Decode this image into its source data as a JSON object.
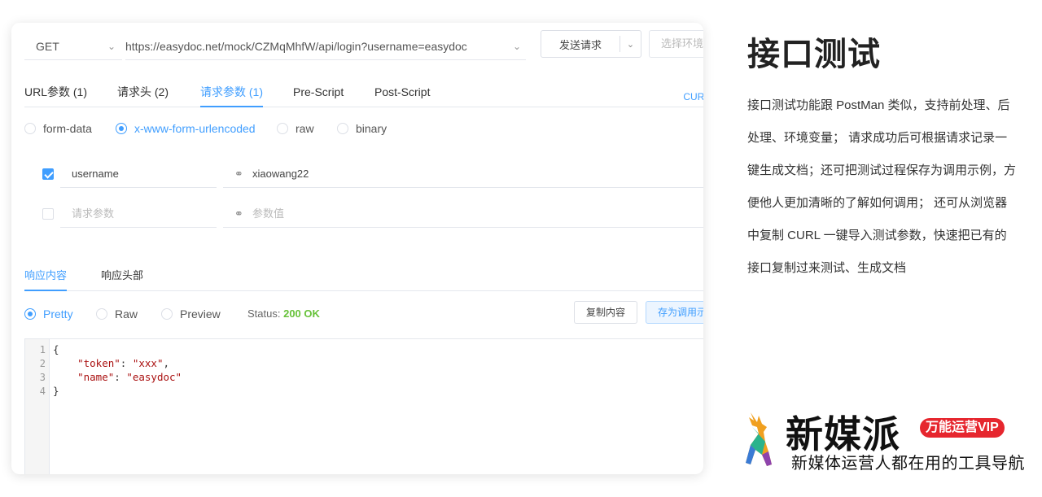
{
  "request": {
    "method": "GET",
    "url": "https://easydoc.net/mock/CZMqMhfW/api/login?username=easydoc",
    "send_label": "发送请求",
    "env_placeholder": "选择环境"
  },
  "tabs": [
    {
      "label": "URL参数 (1)",
      "active": false
    },
    {
      "label": "请求头 (2)",
      "active": false
    },
    {
      "label": "请求参数 (1)",
      "active": true
    },
    {
      "label": "Pre-Script",
      "active": false
    },
    {
      "label": "Post-Script",
      "active": false
    }
  ],
  "curl_label": "CURL导",
  "body_types": [
    {
      "label": "form-data",
      "selected": false
    },
    {
      "label": "x-www-form-urlencoded",
      "selected": true
    },
    {
      "label": "raw",
      "selected": false
    },
    {
      "label": "binary",
      "selected": false
    }
  ],
  "params": [
    {
      "checked": true,
      "key": "username",
      "value": "xiaowang22"
    },
    {
      "checked": false,
      "key_placeholder": "请求参数",
      "value_placeholder": "参数值"
    }
  ],
  "response": {
    "tabs": [
      {
        "label": "响应内容",
        "active": true
      },
      {
        "label": "响应头部",
        "active": false
      }
    ],
    "formats": [
      {
        "label": "Pretty",
        "selected": true
      },
      {
        "label": "Raw",
        "selected": false
      },
      {
        "label": "Preview",
        "selected": false
      }
    ],
    "status_label": "Status:",
    "status_value": "200 OK",
    "status_color": "#67c23a",
    "copy_label": "复制内容",
    "save_label": "存为调用示例",
    "code_lines": [
      {
        "n": "1",
        "text": "{"
      },
      {
        "n": "2",
        "text": "    \"token\": \"xxx\","
      },
      {
        "n": "3",
        "text": "    \"name\": \"easydoc\""
      },
      {
        "n": "4",
        "text": "}"
      }
    ]
  },
  "intro": {
    "title": "接口测试",
    "description": "接口测试功能跟 PostMan 类似，支持前处理、后处理、环境变量； 请求成功后可根据请求记录一键生成文档；还可把测试过程保存为调用示例，方便他人更加清晰的了解如何调用； 还可从浏览器中复制 CURL 一键导入测试参数，快速把已有的接口复制过来测试、生成文档"
  },
  "watermark": {
    "brand": "新媒派",
    "badge": "万能运营VIP",
    "tagline": "新媒体运营人都在用的工具导航"
  },
  "colors": {
    "accent": "#409eff",
    "badge": "#e6262e"
  }
}
